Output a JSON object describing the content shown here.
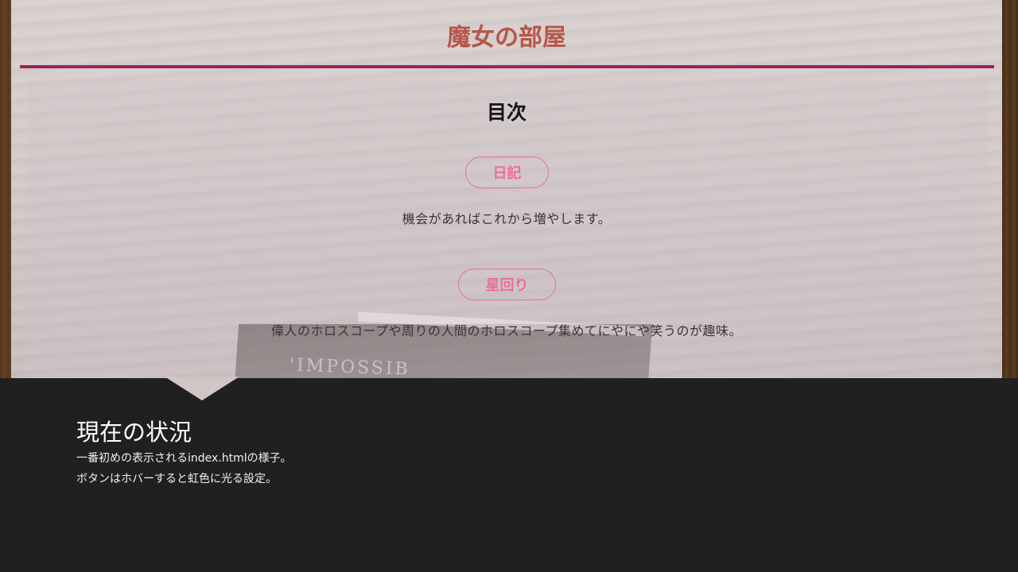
{
  "site": {
    "title": "魔女の部屋"
  },
  "toc": {
    "heading": "目次",
    "items": [
      {
        "label": "日記",
        "description": "機会があればこれから増やします。"
      },
      {
        "label": "星回り",
        "description": "偉人のホロスコープや周りの人間のホロスコープ集めてにやにや笑うのが趣味。"
      }
    ]
  },
  "background": {
    "book_text": "'IMPOSSIB"
  },
  "caption": {
    "title": "現在の状況",
    "lines": [
      "一番初めの表示されるindex.htmlの様子。",
      "ボタンはホバーすると虹色に光る設定。"
    ]
  },
  "colors": {
    "title": "#b5574a",
    "rule": "#9b2458",
    "button": "#ec6d9b",
    "caption_bg": "#202020"
  }
}
